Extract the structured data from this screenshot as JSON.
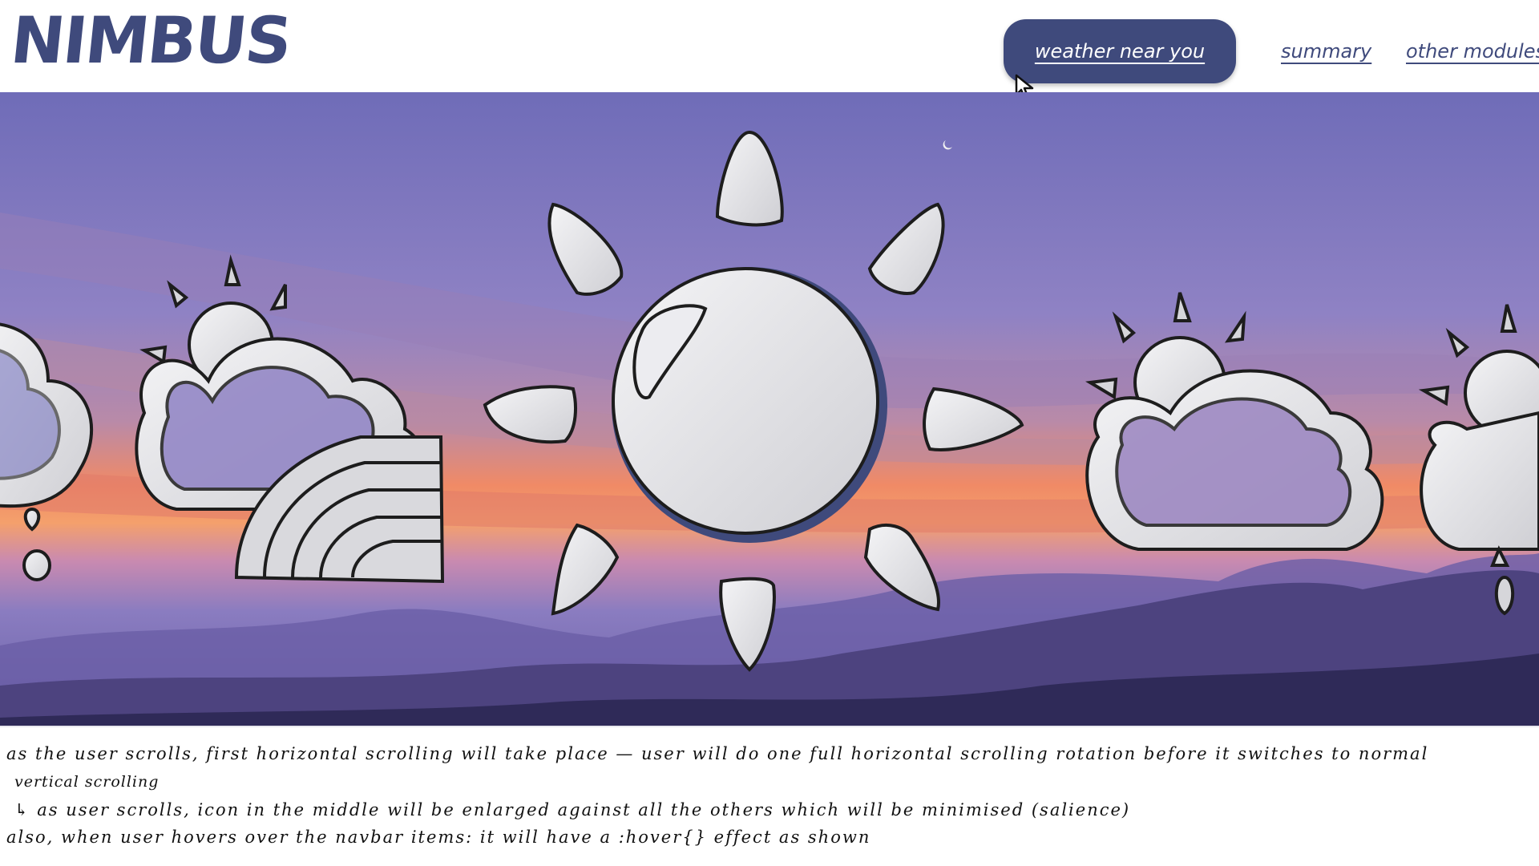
{
  "app": {
    "logo": "NIMBUS"
  },
  "nav": {
    "items": [
      {
        "label": "weather near you",
        "active": true
      },
      {
        "label": "summary",
        "active": false
      },
      {
        "label": "other modules",
        "active": false
      }
    ]
  },
  "hero": {
    "icons": [
      "partly-cloudy-rain-icon",
      "cloud-rainbow-icon",
      "sun-icon",
      "partly-cloudy-icon",
      "partly-cloudy-rain-icon"
    ],
    "centered_icon": "sun-icon"
  },
  "notes": {
    "line1": "as the user scrolls, first horizontal scrolling will take place — user will do one full horizontal scrolling rotation before it switches to normal",
    "line2": "vertical scrolling",
    "line3": "↳ as user scrolls, icon in the middle will be enlarged against all the others which will be minimised (salience)",
    "line4": "also, when user hovers over the navbar items: it will have a :hover{} effect as shown"
  },
  "colors": {
    "brand": "#3f4a7c",
    "sky_top": "#7a78c0",
    "sky_glow": "#f07a5a",
    "mountains": "#3a2f6e"
  }
}
